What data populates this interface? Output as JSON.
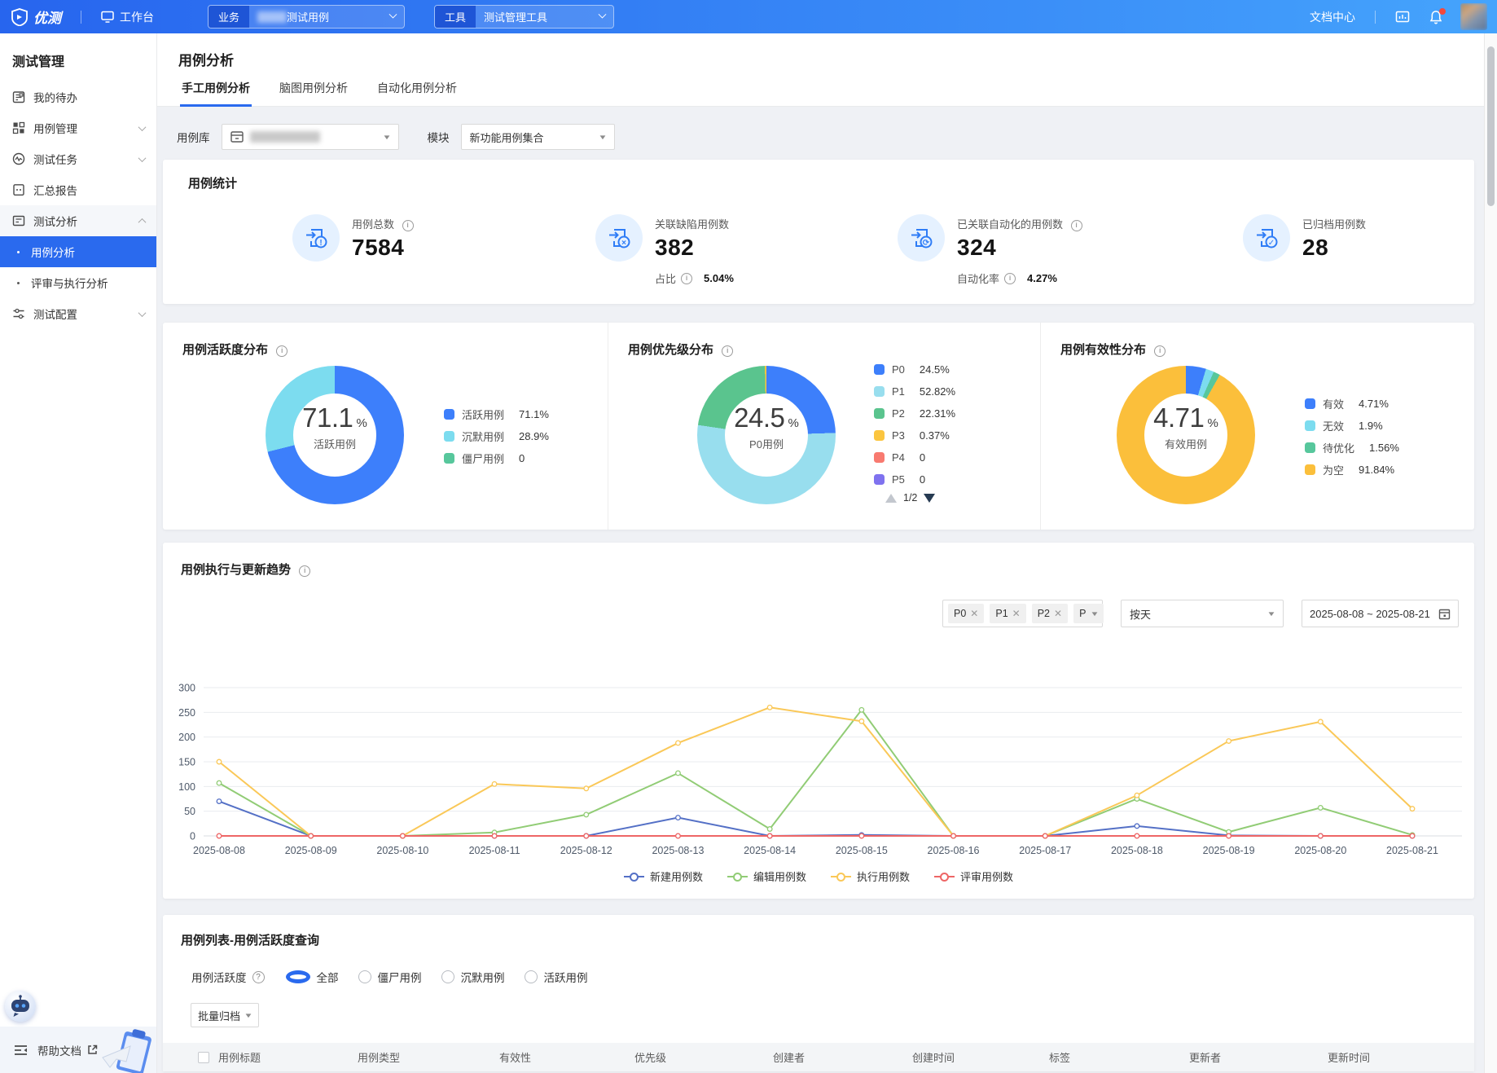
{
  "topbar": {
    "brand": "优测",
    "workbench": "工作台",
    "business": {
      "label": "业务",
      "value": "测试用例"
    },
    "tool": {
      "label": "工具",
      "value": "测试管理工具"
    },
    "doc_center": "文档中心"
  },
  "sidebar": {
    "title": "测试管理",
    "items": [
      {
        "label": "我的待办",
        "icon": "todo-icon"
      },
      {
        "label": "用例管理",
        "icon": "case-manage-icon",
        "chevron": "down"
      },
      {
        "label": "测试任务",
        "icon": "test-task-icon",
        "chevron": "down"
      },
      {
        "label": "汇总报告",
        "icon": "summary-report-icon"
      },
      {
        "label": "测试分析",
        "icon": "test-analysis-icon",
        "chevron": "up",
        "open": true
      },
      {
        "label": "用例分析",
        "sub": true,
        "active": true
      },
      {
        "label": "评审与执行分析",
        "sub": true
      },
      {
        "label": "测试配置",
        "icon": "test-config-icon",
        "chevron": "down"
      }
    ],
    "help": "帮助文档"
  },
  "page": {
    "title": "用例分析",
    "tabs": [
      "手工用例分析",
      "脑图用例分析",
      "自动化用例分析"
    ],
    "filters": {
      "repo_label": "用例库",
      "module_label": "模块",
      "module_value": "新功能用例集合"
    }
  },
  "stats": {
    "title": "用例统计",
    "items": [
      {
        "label": "用例总数",
        "info": true,
        "value": "7584",
        "badge": "!"
      },
      {
        "label": "关联缺陷用例数",
        "info": false,
        "value": "382",
        "sub_label": "占比",
        "sub_value": "5.04%",
        "badge": "x"
      },
      {
        "label": "已关联自动化的用例数",
        "info": true,
        "value": "324",
        "sub_label": "自动化率",
        "sub_value": "4.27%",
        "badge": "r"
      },
      {
        "label": "已归档用例数",
        "info": false,
        "value": "28",
        "badge": "c"
      }
    ]
  },
  "chart_data": [
    {
      "type": "pie",
      "title": "用例活跃度分布",
      "center_value": "71.1",
      "center_unit": "%",
      "center_label": "活跃用例",
      "slices": [
        {
          "label": "活跃用例",
          "value": "71.1%",
          "pct": 71.1,
          "color": "#3D7FFB"
        },
        {
          "label": "沉默用例",
          "value": "28.9%",
          "pct": 28.9,
          "color": "#7CDCEF"
        },
        {
          "label": "僵尸用例",
          "value": "0",
          "pct": 0,
          "color": "#57C79C"
        }
      ]
    },
    {
      "type": "pie",
      "title": "用例优先级分布",
      "center_value": "24.5",
      "center_unit": "%",
      "center_label": "P0用例",
      "slices": [
        {
          "label": "P0",
          "value": "24.5%",
          "pct": 24.5,
          "color": "#3D7FFB"
        },
        {
          "label": "P1",
          "value": "52.82%",
          "pct": 52.82,
          "color": "#98DEEE"
        },
        {
          "label": "P2",
          "value": "22.31%",
          "pct": 22.31,
          "color": "#5AC48E"
        },
        {
          "label": "P3",
          "value": "0.37%",
          "pct": 0.37,
          "color": "#FBC53F"
        },
        {
          "label": "P4",
          "value": "0",
          "pct": 0,
          "color": "#F87A70"
        },
        {
          "label": "P5",
          "value": "0",
          "pct": 0,
          "color": "#7F72EF"
        }
      ],
      "pagination": "1/2"
    },
    {
      "type": "pie",
      "title": "用例有效性分布",
      "center_value": "4.71",
      "center_unit": "%",
      "center_label": "有效用例",
      "slices": [
        {
          "label": "有效",
          "value": "4.71%",
          "pct": 4.71,
          "color": "#3D7FFB"
        },
        {
          "label": "无效",
          "value": "1.9%",
          "pct": 1.9,
          "color": "#7CDCEF"
        },
        {
          "label": "待优化",
          "value": "1.56%",
          "pct": 1.56,
          "color": "#57C79C"
        },
        {
          "label": "为空",
          "value": "91.84%",
          "pct": 91.84,
          "color": "#FBBF3B"
        }
      ]
    },
    {
      "type": "line",
      "title": "用例执行与更新趋势",
      "filter_tags": [
        "P0",
        "P1",
        "P2"
      ],
      "filter_more": "P",
      "granularity": "按天",
      "date_range": "2025-08-08 ~ 2025-08-21",
      "x": [
        "2025-08-08",
        "2025-08-09",
        "2025-08-10",
        "2025-08-11",
        "2025-08-12",
        "2025-08-13",
        "2025-08-14",
        "2025-08-15",
        "2025-08-16",
        "2025-08-17",
        "2025-08-18",
        "2025-08-19",
        "2025-08-20",
        "2025-08-21"
      ],
      "ylim": [
        0,
        300
      ],
      "ytick_step": 50,
      "grid": true,
      "legend_position": "bottom",
      "series": [
        {
          "name": "新建用例数",
          "color": "#5470C6",
          "values": [
            70,
            0,
            0,
            0,
            0,
            37,
            0,
            2,
            0,
            0,
            20,
            1,
            0,
            0
          ]
        },
        {
          "name": "编辑用例数",
          "color": "#91CC75",
          "values": [
            107,
            0,
            0,
            7,
            43,
            127,
            14,
            255,
            0,
            0,
            75,
            8,
            57,
            2
          ]
        },
        {
          "name": "执行用例数",
          "color": "#FAC858",
          "values": [
            150,
            0,
            0,
            105,
            96,
            188,
            260,
            232,
            0,
            0,
            82,
            192,
            231,
            55
          ]
        },
        {
          "name": "评审用例数",
          "color": "#EE6666",
          "values": [
            0,
            0,
            0,
            0,
            0,
            0,
            0,
            0,
            0,
            0,
            0,
            0,
            0,
            0
          ]
        }
      ]
    }
  ],
  "case_list": {
    "title": "用例列表-用例活跃度查询",
    "activity_label": "用例活跃度",
    "radios": [
      "全部",
      "僵尸用例",
      "沉默用例",
      "活跃用例"
    ],
    "selected_radio": 0,
    "archive_button": "批量归档",
    "columns": [
      "用例标题",
      "用例类型",
      "有效性",
      "优先级",
      "创建者",
      "创建时间",
      "标签",
      "更新者",
      "更新时间"
    ]
  },
  "pager": {
    "current": "1/2"
  }
}
